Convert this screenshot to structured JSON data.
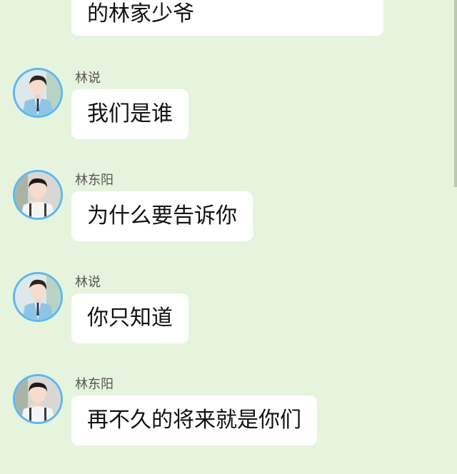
{
  "colors": {
    "background": "#e7f4dd",
    "bubble": "#ffffff",
    "avatar_ring": "#5cb7f0"
  },
  "messages": [
    {
      "text": "的林家少爷",
      "sender": "",
      "avatar": "",
      "partial": true
    },
    {
      "sender": "林说",
      "text": "我们是谁",
      "avatar": "boy-in-blue-cardigan-avatar"
    },
    {
      "sender": "林东阳",
      "text": "为什么要告诉你",
      "avatar": "boy-in-white-shirt-avatar"
    },
    {
      "sender": "林说",
      "text": "你只知道",
      "avatar": "boy-in-blue-cardigan-avatar"
    },
    {
      "sender": "林东阳",
      "text": "再不久的将来就是你们",
      "avatar": "boy-in-white-shirt-avatar"
    }
  ]
}
